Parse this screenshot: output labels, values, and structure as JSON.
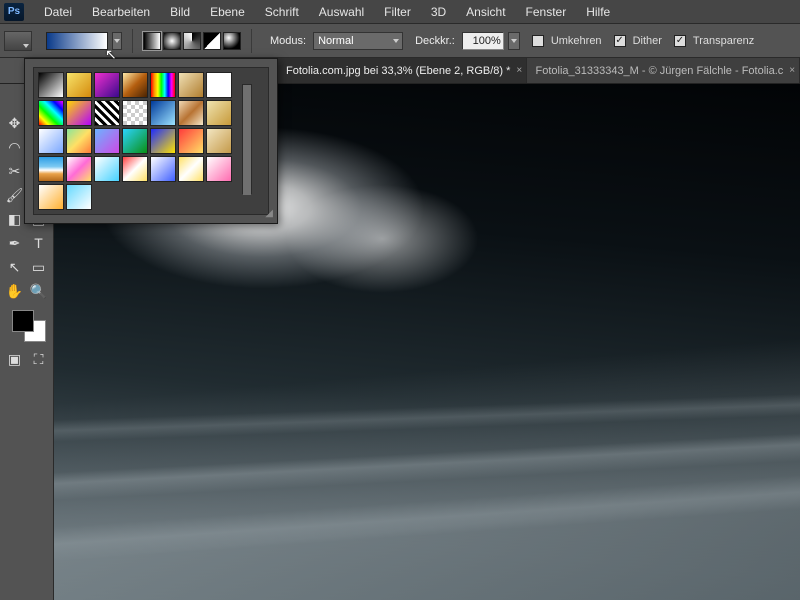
{
  "app_logo": "Ps",
  "menu": [
    "Datei",
    "Bearbeiten",
    "Bild",
    "Ebene",
    "Schrift",
    "Auswahl",
    "Filter",
    "3D",
    "Ansicht",
    "Fenster",
    "Hilfe"
  ],
  "options": {
    "modus_label": "Modus:",
    "modus_value": "Normal",
    "deckkr_label": "Deckkr.:",
    "deckkr_value": "100%",
    "umkehren": "Umkehren",
    "dither": "Dither",
    "transparenz": "Transparenz"
  },
  "tabs": [
    {
      "label": "Fotolia.com.jpg bei 33,3% (Ebene 2, RGB/8) *",
      "active": true
    },
    {
      "label": "Fotolia_31333343_M - © Jürgen Fälchle - Fotolia.c",
      "active": false
    }
  ],
  "gradients": [
    "linear-gradient(135deg,#000,#fff)",
    "linear-gradient(135deg,#f7e36a,#d48a0c)",
    "linear-gradient(135deg,#ef2fcf,#3a0a8c)",
    "linear-gradient(135deg,#fde8a7,#b55f0f,#4a2403)",
    "linear-gradient(90deg,#ff0000,#ff9900,#ffff00,#00ff00,#00ffff,#0000ff,#ff00ff,#ff0000)",
    "linear-gradient(135deg,#efe0b5,#b07d2e)",
    "linear-gradient(135deg,#fff,#fff)",
    "linear-gradient(45deg,#ff0000,#ffff00,#00ff00,#00ffff,#0000ff,#ff00ff)",
    "linear-gradient(135deg,#ffd800,#b300ff)",
    "repeating-linear-gradient(45deg,#000 0 3px,#fff 3px 6px)",
    "repeating-conic-gradient(#ccc 0 25%,#fff 0 50%)",
    "linear-gradient(135deg,#003a9b,#9de3ff)",
    "linear-gradient(135deg,#f0d9b5,#b87333,#f5e7c8)",
    "linear-gradient(135deg,#efe3b0,#c79a3a)",
    "linear-gradient(135deg,#fff,#7aa7ff)",
    "linear-gradient(135deg,#89e59a,#ffe066,#ff7b39)",
    "linear-gradient(135deg,#6cb3ff,#cf49e6)",
    "linear-gradient(135deg,#2bd4ff,#0a8f13)",
    "linear-gradient(135deg,#1d2bff,#ffe400)",
    "linear-gradient(135deg,#ff3b3b,#ffe066)",
    "linear-gradient(135deg,#f3e6c2,#c49a4a)",
    "linear-gradient(180deg,#2d9de6 0%,#7cc9f2 40%,#fff 55%,#e9a24a 70%,#b56a1c 100%)",
    "linear-gradient(135deg,#fff,#ff6bd6,#ffe066)",
    "linear-gradient(135deg,#fff,#46d2ff)",
    "linear-gradient(135deg,#ff4040,#fff,#ffe066)",
    "linear-gradient(135deg,#fff,#4060ff)",
    "linear-gradient(135deg,#ffe066,#fff,#ffe066)",
    "linear-gradient(135deg,#fff,#ff6bb0)",
    "linear-gradient(135deg,#fff,#ffb030)",
    "linear-gradient(135deg,#66d9ff,#fff)"
  ],
  "current_gradient": "linear-gradient(90deg,#0a3a8a,#ffffff)",
  "grad_types": [
    "linear-gradient(90deg,#000,#fff)",
    "radial-gradient(circle,#fff,#000)",
    "conic-gradient(#000,#fff)",
    "linear-gradient(135deg,#000 0%,#000 50%,#fff 50%,#fff 100%)",
    "radial-gradient(circle at 30% 30%,#fff,#000 70%)"
  ],
  "colors": {
    "fg": "#000000",
    "bg": "#ffffff"
  }
}
